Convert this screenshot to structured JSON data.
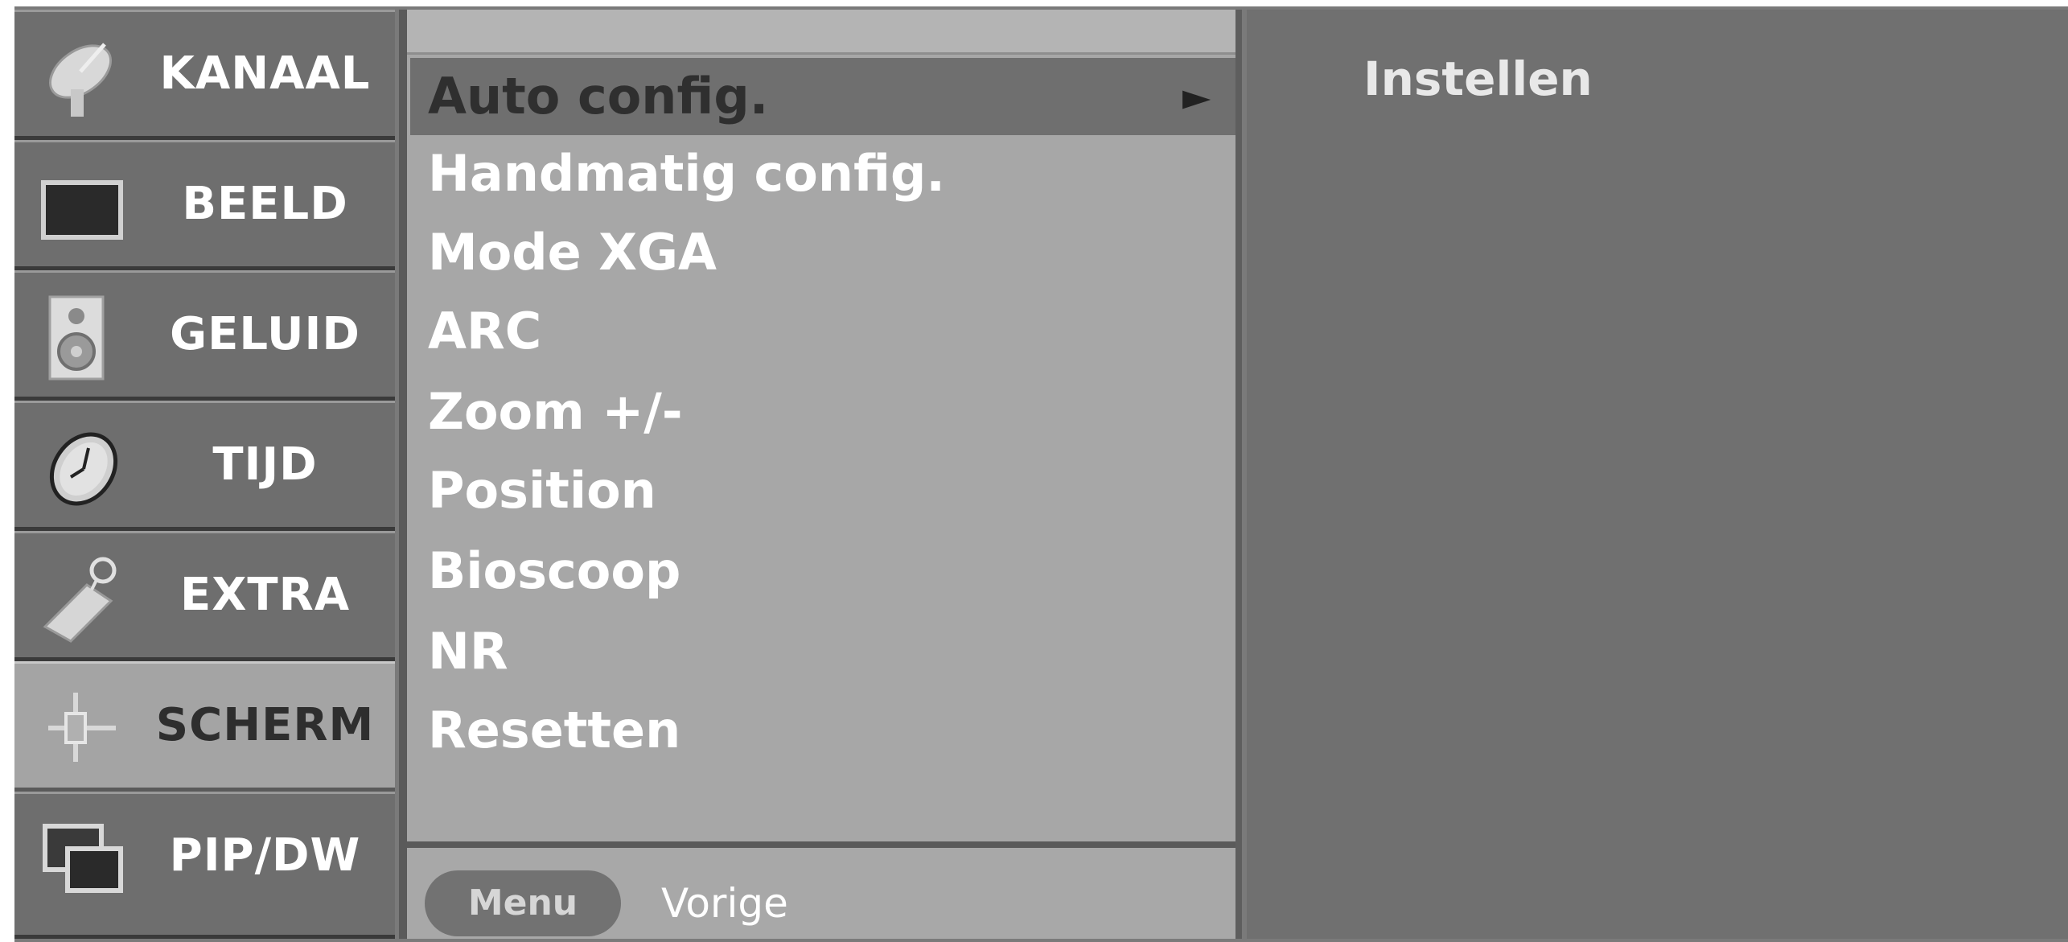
{
  "categories": [
    {
      "label": "KANAAL",
      "icon": "satellite-dish-icon",
      "selected": false
    },
    {
      "label": "BEELD",
      "icon": "picture-screen-icon",
      "selected": false
    },
    {
      "label": "GELUID",
      "icon": "speaker-icon",
      "selected": false
    },
    {
      "label": "TIJD",
      "icon": "clock-icon",
      "selected": false
    },
    {
      "label": "EXTRA",
      "icon": "tag-icon",
      "selected": false
    },
    {
      "label": "SCHERM",
      "icon": "screen-adjust-icon",
      "selected": true
    },
    {
      "label": "PIP/DW",
      "icon": "pip-icon",
      "selected": false
    }
  ],
  "menu": {
    "items": [
      {
        "label": "Auto config.",
        "selected": true
      },
      {
        "label": "Handmatig config."
      },
      {
        "label": "Mode XGA"
      },
      {
        "label": "ARC"
      },
      {
        "label": "Zoom +/-"
      },
      {
        "label": "Position"
      },
      {
        "label": "Bioscoop"
      },
      {
        "label": "NR"
      },
      {
        "label": "Resetten"
      }
    ],
    "submenu_arrow": "►"
  },
  "footer": {
    "menu_button": "Menu",
    "back_label": "Vorige"
  },
  "detail": {
    "label": "Instellen"
  },
  "colors": {
    "panel_bg": "#a7a7a7",
    "selected_bg": "#6f6f6f",
    "category_bg": "#6e6e6e",
    "category_selected_bg": "#a4a4a4"
  }
}
